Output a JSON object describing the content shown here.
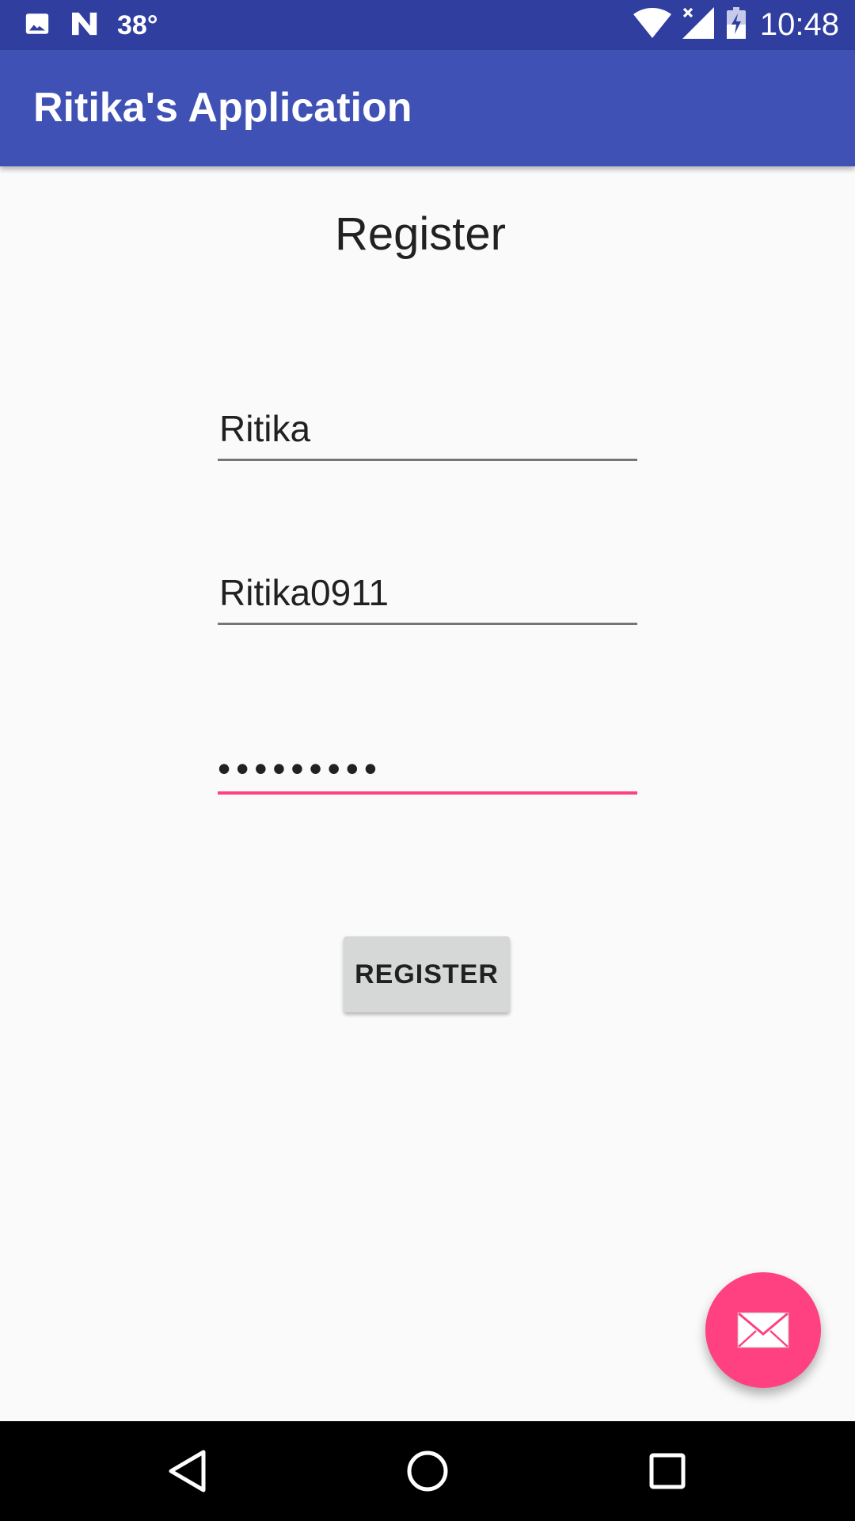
{
  "status_bar": {
    "temperature": "38°",
    "time": "10:48",
    "icons": [
      "image-icon",
      "n-logo-icon",
      "wifi-icon",
      "signal-no-data-icon",
      "battery-charging-icon"
    ]
  },
  "app_bar": {
    "title": "Ritika's Application",
    "color": "#3f51b5"
  },
  "form": {
    "heading": "Register",
    "name_value": "Ritika",
    "username_value": "Ritika0911",
    "password_mask": "•••••••••",
    "register_label": "REGISTER"
  },
  "fab": {
    "icon": "mail-icon",
    "color": "#ff4081"
  },
  "nav_bar": {
    "icons": [
      "back-icon",
      "home-icon",
      "recents-icon"
    ]
  }
}
